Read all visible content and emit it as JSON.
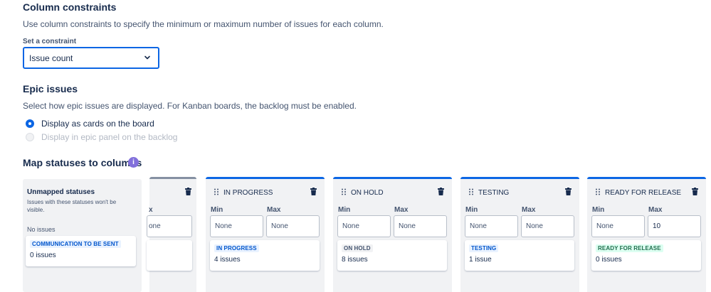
{
  "constraints": {
    "heading": "Column constraints",
    "description": "Use column constraints to specify the minimum or maximum number of issues for each column.",
    "set_label": "Set a constraint",
    "selected": "Issue count"
  },
  "epic": {
    "heading": "Epic issues",
    "description": "Select how epic issues are displayed. For Kanban boards, the backlog must be enabled.",
    "option1": "Display as cards on the board",
    "option2": "Display in epic panel on the backlog"
  },
  "map": {
    "heading": "Map statuses to columns",
    "info_glyph": "i"
  },
  "unmapped": {
    "title": "Unmapped statuses",
    "subtitle": "Issues with these statuses won't be visible.",
    "empty": "No issues",
    "status": "COMMUNICATION TO BE SENT",
    "count": "0 issues"
  },
  "labels": {
    "min": "Min",
    "max": "Max"
  },
  "partial_column": {
    "max_fragment": "x",
    "value_fragment": "one"
  },
  "columns": [
    {
      "name": "IN PROGRESS",
      "min": "None",
      "max": "None",
      "status": "IN PROGRESS",
      "count": "4 issues"
    },
    {
      "name": "ON HOLD",
      "min": "None",
      "max": "None",
      "status": "ON HOLD",
      "count": "8 issues"
    },
    {
      "name": "TESTING",
      "min": "None",
      "max": "None",
      "status": "TESTING",
      "count": "1 issue"
    },
    {
      "name": "READY FOR RELEASE",
      "min": "None",
      "max": "10",
      "status": "READY FOR RELEASE",
      "count": "0 issues"
    }
  ],
  "colors": {
    "accent": "#0c66e4",
    "info": "#8270db",
    "done_green": "#216e4e"
  }
}
